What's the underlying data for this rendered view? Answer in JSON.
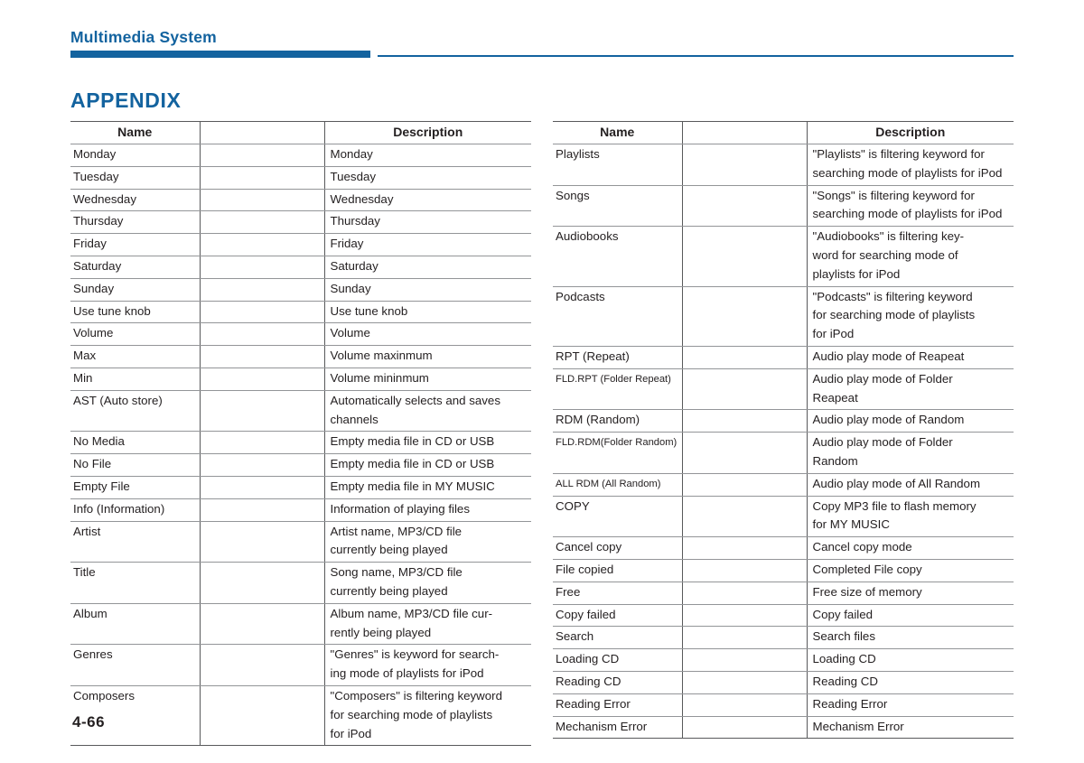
{
  "header": {
    "title": "Multimedia System",
    "accent_color": "#13639f"
  },
  "section": {
    "heading": "APPENDIX"
  },
  "folio": {
    "page_number": "4-66"
  },
  "tables": {
    "columns": {
      "name": "Name",
      "middle": "",
      "description": "Description"
    },
    "left": {
      "header": {
        "name": "Name",
        "middle": "",
        "description": "Description"
      },
      "rows": [
        {
          "name": "Monday",
          "size": "normal",
          "desc": [
            "Monday"
          ]
        },
        {
          "name": "Tuesday",
          "size": "normal",
          "desc": [
            "Tuesday"
          ]
        },
        {
          "name": "Wednesday",
          "size": "normal",
          "desc": [
            "Wednesday"
          ]
        },
        {
          "name": "Thursday",
          "size": "normal",
          "desc": [
            "Thursday"
          ]
        },
        {
          "name": "Friday",
          "size": "normal",
          "desc": [
            "Friday"
          ]
        },
        {
          "name": "Saturday",
          "size": "normal",
          "desc": [
            "Saturday"
          ]
        },
        {
          "name": "Sunday",
          "size": "normal",
          "desc": [
            "Sunday"
          ]
        },
        {
          "name": "Use tune knob",
          "size": "normal",
          "desc": [
            "Use tune knob"
          ]
        },
        {
          "name": "Volume",
          "size": "normal",
          "desc": [
            "Volume"
          ]
        },
        {
          "name": "Max",
          "size": "normal",
          "desc": [
            "Volume maxinmum"
          ]
        },
        {
          "name": "Min",
          "size": "normal",
          "desc": [
            "Volume mininmum"
          ]
        },
        {
          "name": "AST (Auto store)",
          "size": "normal",
          "desc": [
            "Automatically selects and saves",
            "channels"
          ]
        },
        {
          "name": "No Media",
          "size": "normal",
          "desc": [
            "Empty media file in CD or USB"
          ]
        },
        {
          "name": "No File",
          "size": "normal",
          "desc": [
            "Empty media file in CD or USB"
          ]
        },
        {
          "name": "Empty File",
          "size": "normal",
          "desc": [
            "Empty media file in MY MUSIC"
          ]
        },
        {
          "name": "Info (Information)",
          "size": "normal",
          "desc": [
            "Information of playing files"
          ]
        },
        {
          "name": "Artist",
          "size": "normal",
          "desc": [
            "Artist name, MP3/CD file",
            "currently being played"
          ]
        },
        {
          "name": "Title",
          "size": "normal",
          "desc": [
            "Song name, MP3/CD file",
            "currently being played"
          ]
        },
        {
          "name": "Album",
          "size": "normal",
          "desc": [
            "Album name, MP3/CD file cur-",
            "rently being played"
          ]
        },
        {
          "name": "Genres",
          "size": "normal",
          "desc": [
            "\"Genres\" is keyword for search-",
            "ing mode of playlists for iPod"
          ]
        },
        {
          "name": "Composers",
          "size": "normal",
          "desc": [
            "\"Composers\" is filtering keyword",
            "for searching mode of playlists",
            "for iPod"
          ]
        }
      ]
    },
    "right": {
      "header": {
        "name": "Name",
        "middle": "",
        "description": "Description"
      },
      "rows": [
        {
          "name": "Playlists",
          "size": "normal",
          "desc": [
            "\"Playlists\" is filtering keyword for",
            "searching mode of playlists for iPod"
          ]
        },
        {
          "name": "Songs",
          "size": "normal",
          "desc": [
            "\"Songs\" is filtering keyword for",
            "searching mode of playlists for iPod"
          ]
        },
        {
          "name": "Audiobooks",
          "size": "normal",
          "desc": [
            "\"Audiobooks\" is filtering key-",
            "word for searching mode of",
            "playlists for iPod"
          ]
        },
        {
          "name": "Podcasts",
          "size": "normal",
          "desc": [
            "\"Podcasts\" is filtering keyword",
            "for searching mode of playlists",
            "for iPod"
          ]
        },
        {
          "name": "RPT (Repeat)",
          "size": "normal",
          "desc": [
            "Audio play mode of Reapeat"
          ]
        },
        {
          "name": "FLD.RPT (Folder Repeat)",
          "size": "small",
          "desc": [
            "Audio play mode of Folder",
            "Reapeat"
          ]
        },
        {
          "name": "RDM (Random)",
          "size": "normal",
          "desc": [
            "Audio play mode of Random"
          ]
        },
        {
          "name": "FLD.RDM(Folder Random)",
          "size": "small",
          "desc": [
            "Audio play mode of Folder",
            "Random"
          ]
        },
        {
          "name": "ALL RDM (All Random)",
          "size": "small",
          "desc": [
            "Audio play mode of All Random"
          ]
        },
        {
          "name": "COPY",
          "size": "normal",
          "desc": [
            "Copy MP3 file to flash memory",
            "for MY MUSIC"
          ]
        },
        {
          "name": "Cancel copy",
          "size": "normal",
          "desc": [
            "Cancel copy mode"
          ]
        },
        {
          "name": "File copied",
          "size": "normal",
          "desc": [
            "Completed File copy"
          ]
        },
        {
          "name": "Free",
          "size": "normal",
          "desc": [
            "Free size of memory"
          ]
        },
        {
          "name": "Copy failed",
          "size": "normal",
          "desc": [
            "Copy failed"
          ]
        },
        {
          "name": "Search",
          "size": "normal",
          "desc": [
            "Search files"
          ]
        },
        {
          "name": "Loading CD",
          "size": "normal",
          "desc": [
            "Loading CD"
          ]
        },
        {
          "name": "Reading CD",
          "size": "normal",
          "desc": [
            "Reading CD"
          ]
        },
        {
          "name": "Reading Error",
          "size": "normal",
          "desc": [
            "Reading Error"
          ]
        },
        {
          "name": "Mechanism Error",
          "size": "normal",
          "desc": [
            "Mechanism Error"
          ]
        }
      ]
    }
  }
}
